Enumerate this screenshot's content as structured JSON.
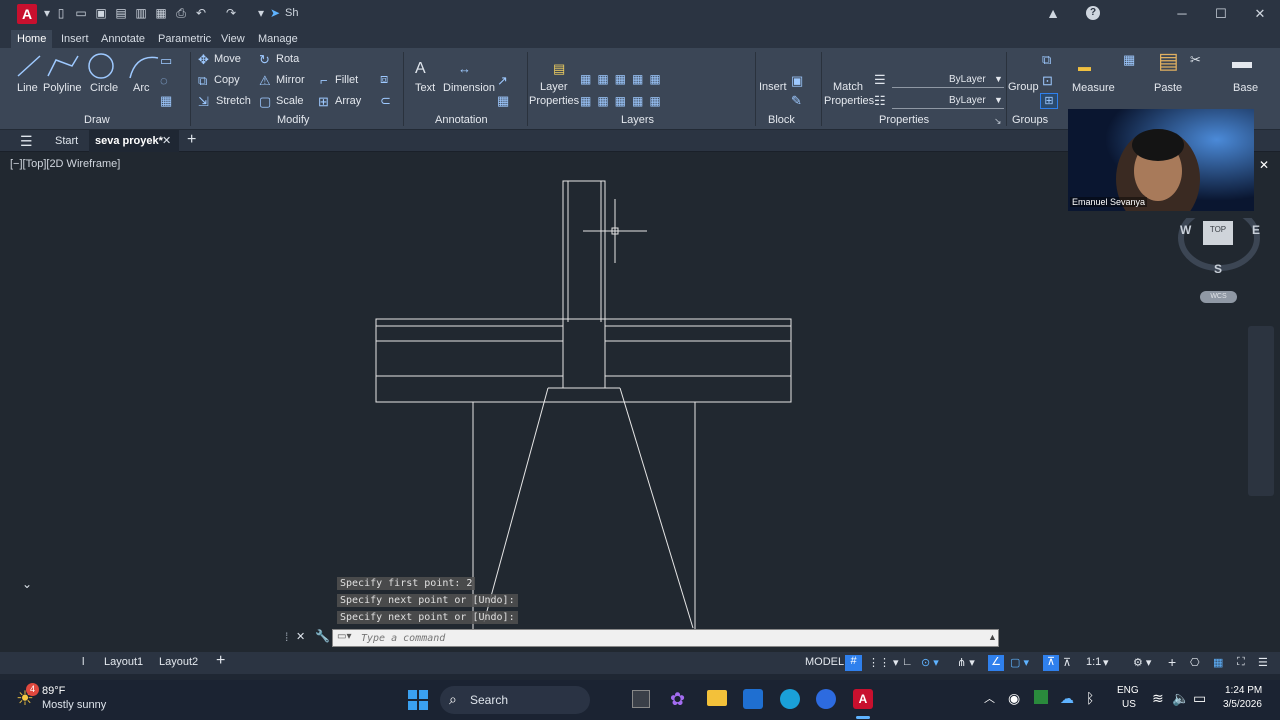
{
  "title_bar": {
    "app_logo": "A",
    "share_label": "Sh",
    "window_controls": [
      "minimize-icon",
      "maximize-icon",
      "close-icon"
    ]
  },
  "ribbon_tabs": [
    "Home",
    "Insert",
    "Annotate",
    "Parametric",
    "View",
    "Manage"
  ],
  "ribbon": {
    "draw": {
      "line": "Line",
      "polyline": "Polyline",
      "circle": "Circle",
      "arc": "Arc",
      "panel": "Draw"
    },
    "modify": {
      "move": "Move",
      "rotate": "Rota",
      "copy": "Copy",
      "mirror": "Mirror",
      "fillet": "Fillet",
      "stretch": "Stretch",
      "scale": "Scale",
      "array": "Array",
      "panel": "Modify"
    },
    "annotation": {
      "text": "Text",
      "dimension": "Dimension",
      "panel": "Annotation"
    },
    "layers": {
      "layer_properties_line1": "Layer",
      "layer_properties_line2": "Properties",
      "panel": "Layers"
    },
    "block": {
      "insert": "Insert",
      "panel": "Block"
    },
    "properties": {
      "match_line1": "Match",
      "match_line2": "Properties",
      "bylayer1": "ByLayer",
      "bylayer2": "ByLayer",
      "panel": "Properties"
    },
    "groups": {
      "group": "Group",
      "panel": "Groups"
    },
    "utilities": {
      "measure": "Measure"
    },
    "clipboard": {
      "paste": "Paste"
    },
    "view": {
      "base": "Base"
    }
  },
  "file_tabs": {
    "start": "Start",
    "active": "seva proyek*"
  },
  "viewport_label": "[−][Top][2D Wireframe]",
  "webcam": {
    "name": "Emanuel Sevanya"
  },
  "navcube": {
    "west": "W",
    "east": "E",
    "south": "S",
    "top": "TOP",
    "wcs": "WCS"
  },
  "command_history": [
    "Specify first point: 2",
    "Specify next point or [Undo]:",
    "Specify next point or [Undo]:"
  ],
  "command_placeholder": "Type a command",
  "layout_tabs": {
    "model_short": "l",
    "layout1": "Layout1",
    "layout2": "Layout2"
  },
  "status": {
    "model": "MODEL",
    "scale": "1:1"
  },
  "taskbar": {
    "weather_temp": "89°F",
    "weather_desc": "Mostly sunny",
    "weather_badge": "4",
    "search": "Search",
    "lang1": "ENG",
    "lang2": "US",
    "time": "1:24 PM",
    "date": "3/5/2026"
  },
  "colors": {
    "ribbon_bg": "#3b4656",
    "canvas_bg": "#212830",
    "accent": "#2f80ed",
    "autocad_red": "#c8102e"
  }
}
